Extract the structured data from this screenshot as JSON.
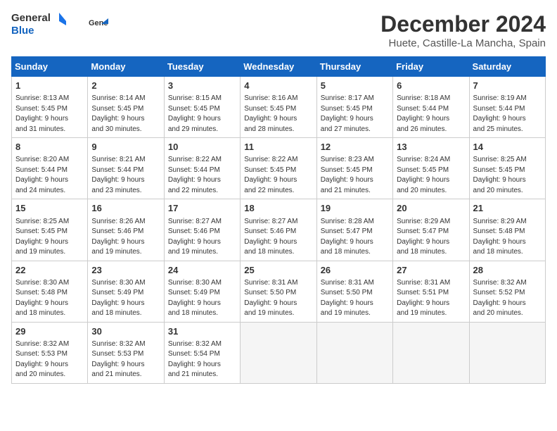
{
  "header": {
    "logo_general": "General",
    "logo_blue": "Blue",
    "title": "December 2024",
    "subtitle": "Huete, Castille-La Mancha, Spain"
  },
  "weekdays": [
    "Sunday",
    "Monday",
    "Tuesday",
    "Wednesday",
    "Thursday",
    "Friday",
    "Saturday"
  ],
  "weeks": [
    [
      {
        "day": "1",
        "info": "Sunrise: 8:13 AM\nSunset: 5:45 PM\nDaylight: 9 hours\nand 31 minutes."
      },
      {
        "day": "2",
        "info": "Sunrise: 8:14 AM\nSunset: 5:45 PM\nDaylight: 9 hours\nand 30 minutes."
      },
      {
        "day": "3",
        "info": "Sunrise: 8:15 AM\nSunset: 5:45 PM\nDaylight: 9 hours\nand 29 minutes."
      },
      {
        "day": "4",
        "info": "Sunrise: 8:16 AM\nSunset: 5:45 PM\nDaylight: 9 hours\nand 28 minutes."
      },
      {
        "day": "5",
        "info": "Sunrise: 8:17 AM\nSunset: 5:45 PM\nDaylight: 9 hours\nand 27 minutes."
      },
      {
        "day": "6",
        "info": "Sunrise: 8:18 AM\nSunset: 5:44 PM\nDaylight: 9 hours\nand 26 minutes."
      },
      {
        "day": "7",
        "info": "Sunrise: 8:19 AM\nSunset: 5:44 PM\nDaylight: 9 hours\nand 25 minutes."
      }
    ],
    [
      {
        "day": "8",
        "info": "Sunrise: 8:20 AM\nSunset: 5:44 PM\nDaylight: 9 hours\nand 24 minutes."
      },
      {
        "day": "9",
        "info": "Sunrise: 8:21 AM\nSunset: 5:44 PM\nDaylight: 9 hours\nand 23 minutes."
      },
      {
        "day": "10",
        "info": "Sunrise: 8:22 AM\nSunset: 5:44 PM\nDaylight: 9 hours\nand 22 minutes."
      },
      {
        "day": "11",
        "info": "Sunrise: 8:22 AM\nSunset: 5:45 PM\nDaylight: 9 hours\nand 22 minutes."
      },
      {
        "day": "12",
        "info": "Sunrise: 8:23 AM\nSunset: 5:45 PM\nDaylight: 9 hours\nand 21 minutes."
      },
      {
        "day": "13",
        "info": "Sunrise: 8:24 AM\nSunset: 5:45 PM\nDaylight: 9 hours\nand 20 minutes."
      },
      {
        "day": "14",
        "info": "Sunrise: 8:25 AM\nSunset: 5:45 PM\nDaylight: 9 hours\nand 20 minutes."
      }
    ],
    [
      {
        "day": "15",
        "info": "Sunrise: 8:25 AM\nSunset: 5:45 PM\nDaylight: 9 hours\nand 19 minutes."
      },
      {
        "day": "16",
        "info": "Sunrise: 8:26 AM\nSunset: 5:46 PM\nDaylight: 9 hours\nand 19 minutes."
      },
      {
        "day": "17",
        "info": "Sunrise: 8:27 AM\nSunset: 5:46 PM\nDaylight: 9 hours\nand 19 minutes."
      },
      {
        "day": "18",
        "info": "Sunrise: 8:27 AM\nSunset: 5:46 PM\nDaylight: 9 hours\nand 18 minutes."
      },
      {
        "day": "19",
        "info": "Sunrise: 8:28 AM\nSunset: 5:47 PM\nDaylight: 9 hours\nand 18 minutes."
      },
      {
        "day": "20",
        "info": "Sunrise: 8:29 AM\nSunset: 5:47 PM\nDaylight: 9 hours\nand 18 minutes."
      },
      {
        "day": "21",
        "info": "Sunrise: 8:29 AM\nSunset: 5:48 PM\nDaylight: 9 hours\nand 18 minutes."
      }
    ],
    [
      {
        "day": "22",
        "info": "Sunrise: 8:30 AM\nSunset: 5:48 PM\nDaylight: 9 hours\nand 18 minutes."
      },
      {
        "day": "23",
        "info": "Sunrise: 8:30 AM\nSunset: 5:49 PM\nDaylight: 9 hours\nand 18 minutes."
      },
      {
        "day": "24",
        "info": "Sunrise: 8:30 AM\nSunset: 5:49 PM\nDaylight: 9 hours\nand 18 minutes."
      },
      {
        "day": "25",
        "info": "Sunrise: 8:31 AM\nSunset: 5:50 PM\nDaylight: 9 hours\nand 19 minutes."
      },
      {
        "day": "26",
        "info": "Sunrise: 8:31 AM\nSunset: 5:50 PM\nDaylight: 9 hours\nand 19 minutes."
      },
      {
        "day": "27",
        "info": "Sunrise: 8:31 AM\nSunset: 5:51 PM\nDaylight: 9 hours\nand 19 minutes."
      },
      {
        "day": "28",
        "info": "Sunrise: 8:32 AM\nSunset: 5:52 PM\nDaylight: 9 hours\nand 20 minutes."
      }
    ],
    [
      {
        "day": "29",
        "info": "Sunrise: 8:32 AM\nSunset: 5:53 PM\nDaylight: 9 hours\nand 20 minutes."
      },
      {
        "day": "30",
        "info": "Sunrise: 8:32 AM\nSunset: 5:53 PM\nDaylight: 9 hours\nand 21 minutes."
      },
      {
        "day": "31",
        "info": "Sunrise: 8:32 AM\nSunset: 5:54 PM\nDaylight: 9 hours\nand 21 minutes."
      },
      {
        "day": "",
        "info": ""
      },
      {
        "day": "",
        "info": ""
      },
      {
        "day": "",
        "info": ""
      },
      {
        "day": "",
        "info": ""
      }
    ]
  ]
}
